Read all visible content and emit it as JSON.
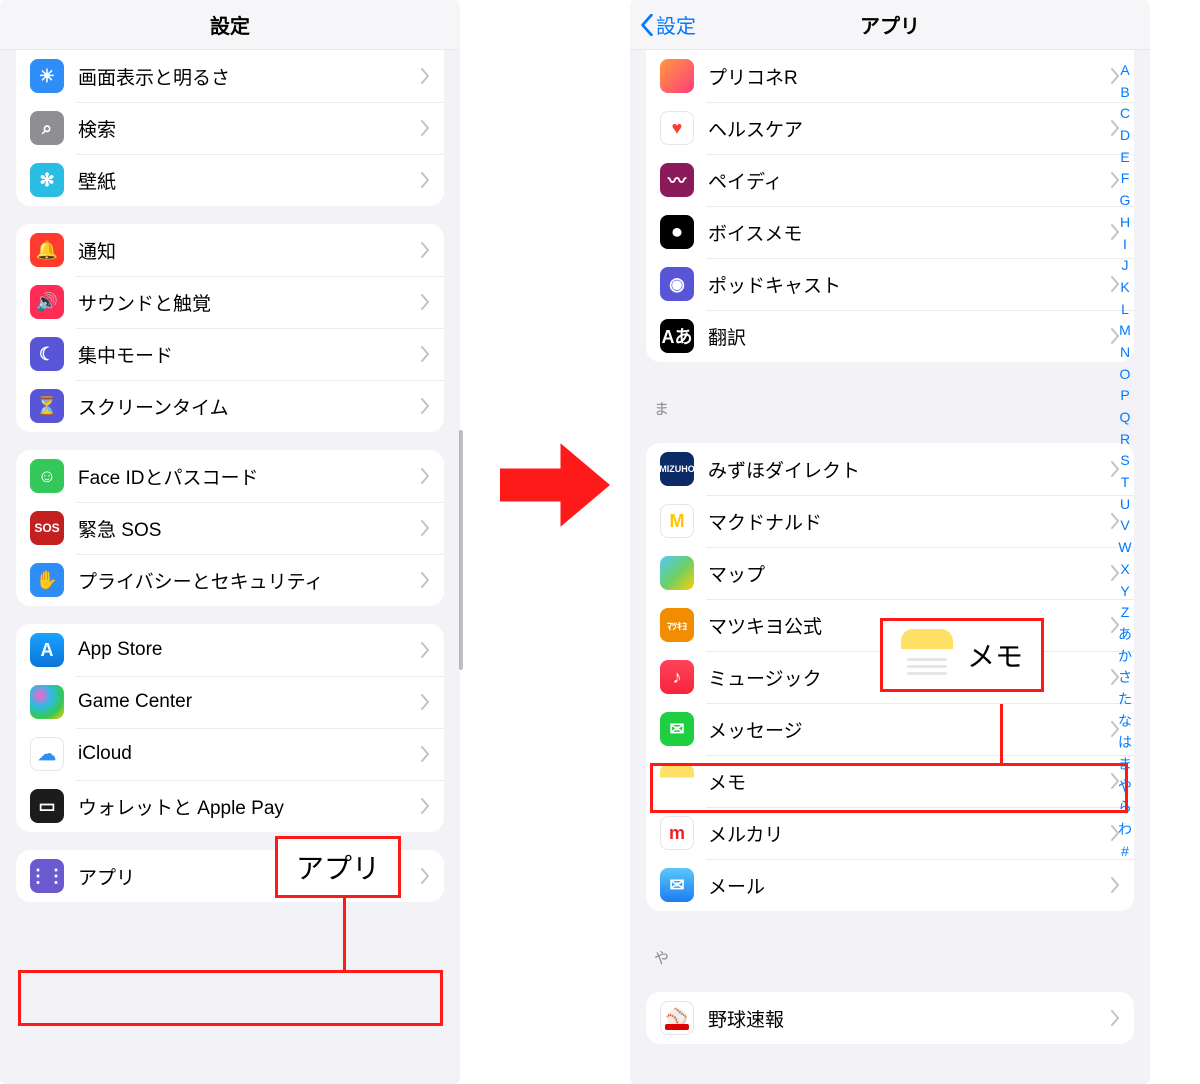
{
  "left": {
    "title": "設定",
    "groups": [
      {
        "cut": true,
        "rows": [
          {
            "id": "display",
            "label": "画面表示と明るさ",
            "iconClass": "ic-blue",
            "glyph": "☀"
          },
          {
            "id": "search",
            "label": "検索",
            "iconClass": "ic-gray",
            "glyph": "⌕"
          },
          {
            "id": "wallpaper",
            "label": "壁紙",
            "iconClass": "ic-cyan",
            "glyph": "✻"
          }
        ]
      },
      {
        "rows": [
          {
            "id": "notifications",
            "label": "通知",
            "iconClass": "ic-red",
            "glyph": "🔔"
          },
          {
            "id": "sounds",
            "label": "サウンドと触覚",
            "iconClass": "ic-pink",
            "glyph": "🔊"
          },
          {
            "id": "focus",
            "label": "集中モード",
            "iconClass": "ic-purple",
            "glyph": "☾"
          },
          {
            "id": "screentime",
            "label": "スクリーンタイム",
            "iconClass": "ic-purple",
            "glyph": "⏳"
          }
        ]
      },
      {
        "rows": [
          {
            "id": "faceid",
            "label": "Face IDとパスコード",
            "iconClass": "ic-green",
            "glyph": "☺"
          },
          {
            "id": "sos",
            "label": "緊急 SOS",
            "iconClass": "ic-darkred",
            "glyph": "SOS"
          },
          {
            "id": "privacy",
            "label": "プライバシーとセキュリティ",
            "iconClass": "ic-blue",
            "glyph": "✋"
          }
        ]
      },
      {
        "rows": [
          {
            "id": "appstore",
            "label": "App Store",
            "iconClass": "ic-appstore",
            "glyph": "A"
          },
          {
            "id": "gamecenter",
            "label": "Game Center",
            "iconClass": "ic-gc",
            "glyph": ""
          },
          {
            "id": "icloud",
            "label": "iCloud",
            "iconClass": "ic-cloud",
            "glyph": "☁"
          },
          {
            "id": "wallet",
            "label": "ウォレットと Apple Pay",
            "iconClass": "ic-wallet",
            "glyph": "▭"
          }
        ]
      },
      {
        "rows": [
          {
            "id": "apps",
            "label": "アプリ",
            "iconClass": "ic-apps",
            "glyph": "⋮⋮"
          }
        ]
      }
    ]
  },
  "right": {
    "title": "アプリ",
    "back": "設定",
    "groups": [
      {
        "cut": true,
        "rows": [
          {
            "id": "prikone",
            "label": "プリコネR",
            "iconClass": "ic-img",
            "glyph": ""
          },
          {
            "id": "health",
            "label": "ヘルスケア",
            "iconClass": "ic-white",
            "glyph": "♥"
          },
          {
            "id": "paidy",
            "label": "ペイディ",
            "iconClass": "ic-plum",
            "glyph": "〰"
          },
          {
            "id": "voicememo",
            "label": "ボイスメモ",
            "iconClass": "ic-black",
            "glyph": "⏺"
          },
          {
            "id": "podcast",
            "label": "ポッドキャスト",
            "iconClass": "ic-purple",
            "glyph": "◉"
          },
          {
            "id": "translate",
            "label": "翻訳",
            "iconClass": "ic-black",
            "glyph": "Aあ"
          }
        ]
      },
      {
        "header": "ま",
        "rows": [
          {
            "id": "mizuho",
            "label": "みずほダイレクト",
            "iconClass": "ic-navy",
            "glyph": "MIZUHO"
          },
          {
            "id": "mcd",
            "label": "マクドナルド",
            "iconClass": "ic-mc",
            "glyph": "M"
          },
          {
            "id": "maps",
            "label": "マップ",
            "iconClass": "ic-maps",
            "glyph": ""
          },
          {
            "id": "matsukiyo",
            "label": "マツキヨ公式",
            "iconClass": "ic-orange",
            "glyph": "ﾏﾂｷﾖ"
          },
          {
            "id": "music",
            "label": "ミュージック",
            "iconClass": "ic-music",
            "glyph": "♪"
          },
          {
            "id": "messages",
            "label": "メッセージ",
            "iconClass": "ic-msg",
            "glyph": "✉"
          },
          {
            "id": "notes",
            "label": "メモ",
            "iconClass": "ic-yellow",
            "glyph": ""
          },
          {
            "id": "mercari",
            "label": "メルカリ",
            "iconClass": "ic-mercari",
            "glyph": "m"
          },
          {
            "id": "mail",
            "label": "メール",
            "iconClass": "ic-mail",
            "glyph": "✉"
          }
        ]
      },
      {
        "header": "や",
        "rows": [
          {
            "id": "baseball",
            "label": "野球速報",
            "iconClass": "ic-baseball",
            "glyph": "⚾"
          }
        ]
      }
    ]
  },
  "index_letters": [
    "A",
    "B",
    "C",
    "D",
    "E",
    "F",
    "G",
    "H",
    "I",
    "J",
    "K",
    "L",
    "M",
    "N",
    "O",
    "P",
    "Q",
    "R",
    "S",
    "T",
    "U",
    "V",
    "W",
    "X",
    "Y",
    "Z",
    "あ",
    "か",
    "さ",
    "た",
    "な",
    "は",
    "ま",
    "や",
    "ら",
    "わ",
    "#"
  ],
  "callouts": {
    "apps_label": "アプリ",
    "notes_label": "メモ"
  }
}
